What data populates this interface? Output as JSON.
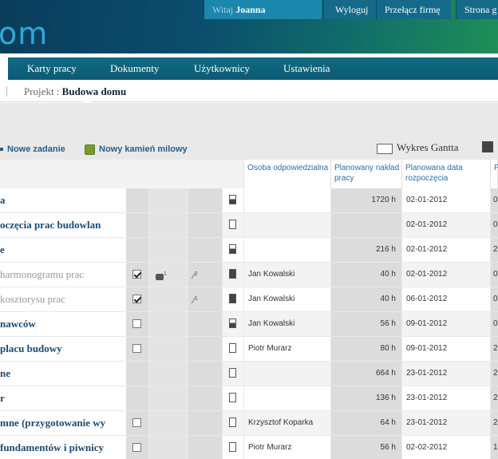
{
  "header": {
    "logo_text": "om",
    "welcome_prefix": "Witaj",
    "user_name": "Joanna",
    "logout_label": "Wyloguj",
    "switch_company_label": "Przełącz firmę",
    "home_label": "Strona g"
  },
  "nav": {
    "items": [
      "Karty pracy",
      "Dokumenty",
      "Użytkownicy",
      "Ustawienia"
    ]
  },
  "breadcrumb": {
    "label": "Projekt :",
    "value": "Budowa domu"
  },
  "toolbar": {
    "new_task": "Nowe zadanie",
    "new_milestone": "Nowy kamień milowy",
    "gantt": "Wykres Gantta"
  },
  "columns": {
    "person": "Osoba odpowiedzialna",
    "hours": "Planowany nakład pracy",
    "start": "Planowana data rozpoczęcia",
    "last": "P"
  },
  "rows": [
    {
      "name": "a",
      "dim": false,
      "chk": "",
      "msg": "",
      "att": "",
      "doc": "half",
      "person": "",
      "hours": "1720 h",
      "date": "02-01-2012",
      "last": "0"
    },
    {
      "name": "oczęcia prac budowlan",
      "dim": false,
      "chk": "",
      "msg": "",
      "att": "",
      "doc": "empty",
      "person": "",
      "hours": "",
      "date": "02-01-2012",
      "last": "0"
    },
    {
      "name": "e",
      "dim": false,
      "chk": "",
      "msg": "",
      "att": "",
      "doc": "half",
      "person": "",
      "hours": "216 h",
      "date": "02-01-2012",
      "last": "2"
    },
    {
      "name": "harmonogramu prac",
      "dim": true,
      "chk": "on",
      "msg": "1",
      "att": "2",
      "doc": "full",
      "person": "Jan Kowalski",
      "hours": "40 h",
      "date": "02-01-2012",
      "last": "0"
    },
    {
      "name": "kosztorysu prac",
      "dim": true,
      "chk": "on",
      "msg": "",
      "att": "1",
      "doc": "full",
      "person": "Jan Kowalski",
      "hours": "40 h",
      "date": "06-01-2012",
      "last": "0"
    },
    {
      "name": "nawców",
      "dim": false,
      "chk": "off",
      "msg": "",
      "att": "",
      "doc": "half",
      "person": "Jan Kowalski",
      "hours": "56 h",
      "date": "09-01-2012",
      "last": "0"
    },
    {
      "name": "placu budowy",
      "dim": false,
      "chk": "off",
      "msg": "",
      "att": "",
      "doc": "empty",
      "person": "Piotr Murarz",
      "hours": "80 h",
      "date": "09-01-2012",
      "last": "2"
    },
    {
      "name": "ne",
      "dim": false,
      "chk": "",
      "msg": "",
      "att": "",
      "doc": "empty",
      "person": "",
      "hours": "664 h",
      "date": "23-01-2012",
      "last": "2"
    },
    {
      "name": "r",
      "dim": false,
      "chk": "",
      "msg": "",
      "att": "",
      "doc": "empty",
      "person": "",
      "hours": "136 h",
      "date": "23-01-2012",
      "last": "2"
    },
    {
      "name": "mne (przygotowanie wy",
      "dim": false,
      "chk": "off",
      "msg": "",
      "att": "",
      "doc": "empty",
      "person": "Krzysztof Koparka",
      "hours": "64 h",
      "date": "23-01-2012",
      "last": "2"
    },
    {
      "name": "fundamentów i piwnicy",
      "dim": false,
      "chk": "off",
      "msg": "",
      "att": "",
      "doc": "empty",
      "person": "Piotr Murarz",
      "hours": "56 h",
      "date": "02-02-2012",
      "last": "1"
    }
  ]
}
